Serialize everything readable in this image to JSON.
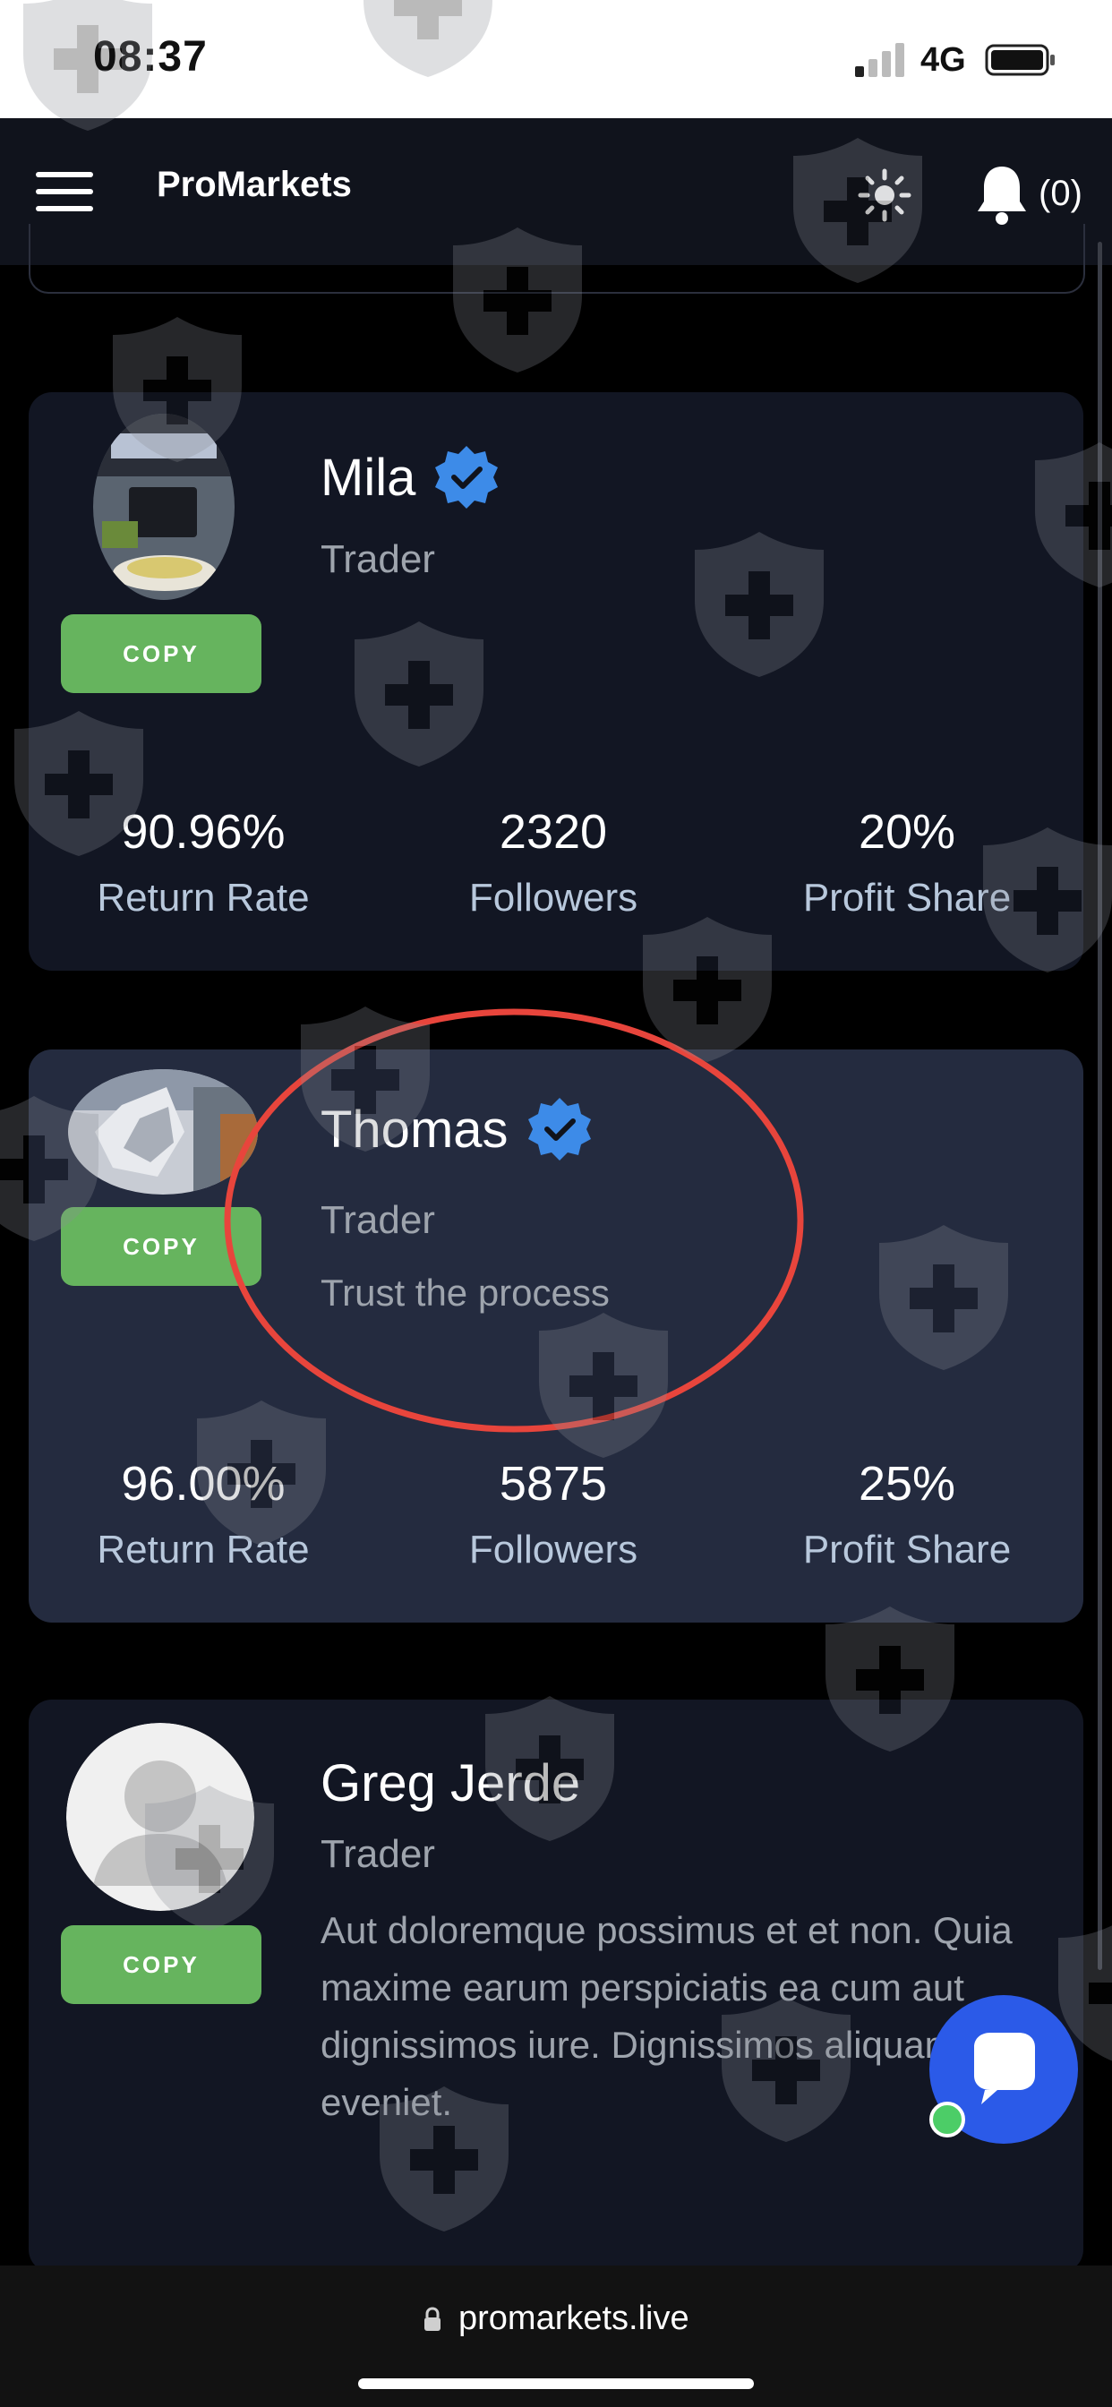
{
  "status_bar": {
    "time": "08:37",
    "network": "4G"
  },
  "header": {
    "brand": "ProMarkets",
    "notification_count": "(0)",
    "menu_icon": "hamburger-icon",
    "theme_icon": "sun-icon",
    "bell_icon": "bell-icon"
  },
  "traders": [
    {
      "name": "Mila",
      "role": "Trader",
      "bio": "",
      "copy_label": "COPY",
      "verified": true,
      "stats": [
        {
          "value": "90.96%",
          "label": "Return Rate"
        },
        {
          "value": "2320",
          "label": "Followers"
        },
        {
          "value": "20%",
          "label": "Profit Share"
        }
      ]
    },
    {
      "name": "Thomas",
      "role": "Trader",
      "bio": "Trust the process",
      "copy_label": "COPY",
      "verified": true,
      "stats": [
        {
          "value": "96.00%",
          "label": "Return Rate"
        },
        {
          "value": "5875",
          "label": "Followers"
        },
        {
          "value": "25%",
          "label": "Profit Share"
        }
      ]
    },
    {
      "name": "Greg Jerde",
      "role": "Trader",
      "bio": "Aut doloremque possimus et et non. Quia maxime earum perspiciatis ea cum aut dignissimos iure. Dignissimos aliquam et eveniet.",
      "copy_label": "COPY",
      "verified": false
    }
  ],
  "browser": {
    "url": "promarkets.live"
  },
  "colors": {
    "copy_button": "#66b45e",
    "verified_badge": "#3d8be8",
    "highlight_ellipse": "#e8453c",
    "chat_button": "#2b5ae8"
  }
}
